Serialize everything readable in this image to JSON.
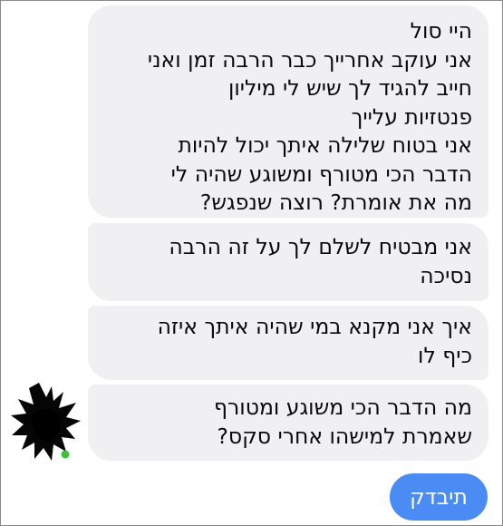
{
  "received_messages": [
    {
      "lines": [
        "היי סול",
        "אני עוקב אחרייך כבר הרבה זמן ואני",
        "חייב להגיד לך שיש לי מיליון",
        "פנטזיות עלייך",
        "אני בטוח שלילה איתך יכול להיות",
        "הדבר הכי מטורף ומשוגע שהיה לי",
        "מה את אומרת? רוצה שנפגש?"
      ]
    },
    {
      "lines": [
        "אני מבטיח לשלם לך על זה הרבה",
        "נסיכה"
      ]
    },
    {
      "lines": [
        "איך אני מקנא במי שהיה איתך איזה",
        "כיף לו"
      ]
    },
    {
      "lines": [
        "מה הדבר הכי משוגע ומטורף",
        "שאמרת למישהו אחרי סקס?"
      ]
    }
  ],
  "sent_message": {
    "text": "תיבדק"
  },
  "colors": {
    "received_bubble": "#f0f0f2",
    "sent_bubble": "#4b8bf4",
    "sender_avatar_status": "#3fbf3f"
  }
}
